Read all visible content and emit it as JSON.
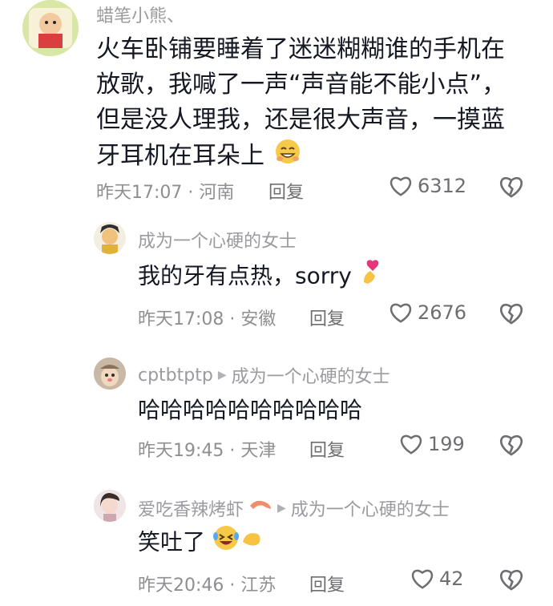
{
  "comments": [
    {
      "user": "蜡笔小熊、",
      "text": "火车卧铺要睡着了迷迷糊糊谁的手机在放歌，我喊了一声“声音能不能小点”，但是没人理我，还是很大声音，一摸蓝牙耳机在耳朵上",
      "time": "昨天17:07 · 河南",
      "reply_label": "回复",
      "likes": "6312",
      "emoji_icon": "grin-sweat-emoji"
    },
    {
      "user": "成为一个心硬的女士",
      "text": "我的牙有点热，sorry",
      "time": "昨天17:08 · 安徽",
      "reply_label": "回复",
      "likes": "2676",
      "emoji_icon": "finger-heart-emoji"
    },
    {
      "user": "cptbtptp",
      "reply_to": "成为一个心硬的女士",
      "text": "哈哈哈哈哈哈哈哈哈哈",
      "time": "昨天19:45 · 天津",
      "reply_label": "回复",
      "likes": "199"
    },
    {
      "user": "爱吃香辣烤虾",
      "reply_to": "成为一个心硬的女士",
      "text": "笑吐了",
      "time": "昨天20:46 · 江苏",
      "reply_label": "回复",
      "likes": "42",
      "emoji_icon": "laughing-tears-emoji"
    }
  ],
  "colors": {
    "text": "#161823",
    "muted": "#8e8e93",
    "accent_yellow": "#f5c21b"
  }
}
